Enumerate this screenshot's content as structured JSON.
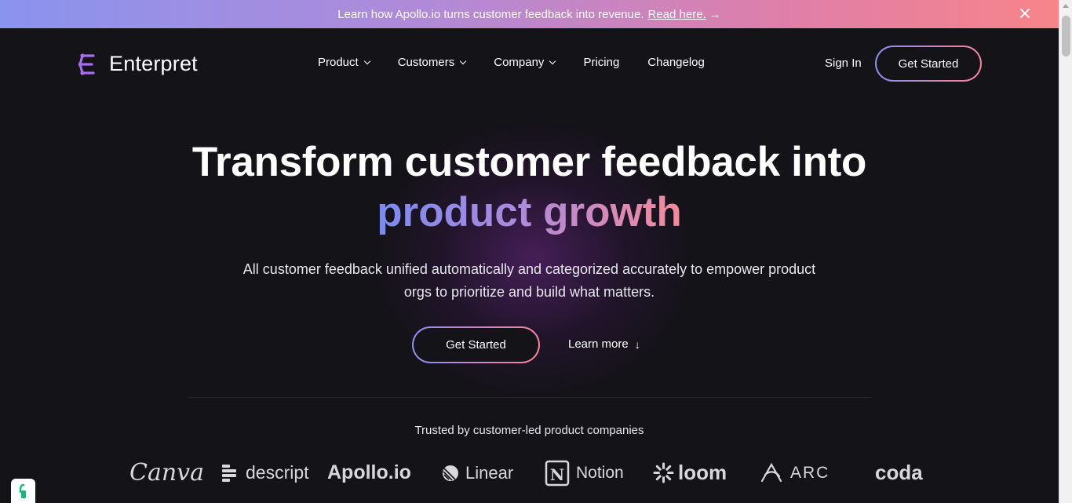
{
  "announcement": {
    "text": "Learn how Apollo.io turns customer feedback into revenue.",
    "link": "Read here.",
    "arrow": "→"
  },
  "nav": {
    "logo": "Enterpret",
    "items": [
      {
        "label": "Product",
        "dropdown": true
      },
      {
        "label": "Customers",
        "dropdown": true
      },
      {
        "label": "Company",
        "dropdown": true
      },
      {
        "label": "Pricing",
        "dropdown": false
      },
      {
        "label": "Changelog",
        "dropdown": false
      }
    ],
    "sign_in": "Sign In",
    "cta": "Get Started"
  },
  "hero": {
    "headline_line1": "Transform customer feedback into",
    "headline_line2": "product growth",
    "subtext_line1": "All customer feedback unified automatically and categorized accurately to empower product",
    "subtext_line2": "orgs to prioritize and build what matters.",
    "primary_cta": "Get Started",
    "secondary_cta": "Learn more",
    "secondary_arrow": "↓"
  },
  "trusted": {
    "title": "Trusted by customer-led product companies",
    "logos": [
      "Canva",
      "descript",
      "Apollo.io",
      "Linear",
      "Notion",
      "loom",
      "ARC",
      "coda"
    ]
  },
  "colors": {
    "background": "#141318",
    "gradient_start": "#8d8ff0",
    "gradient_end": "#f7849a",
    "logo_accent": "#a86cf0"
  }
}
